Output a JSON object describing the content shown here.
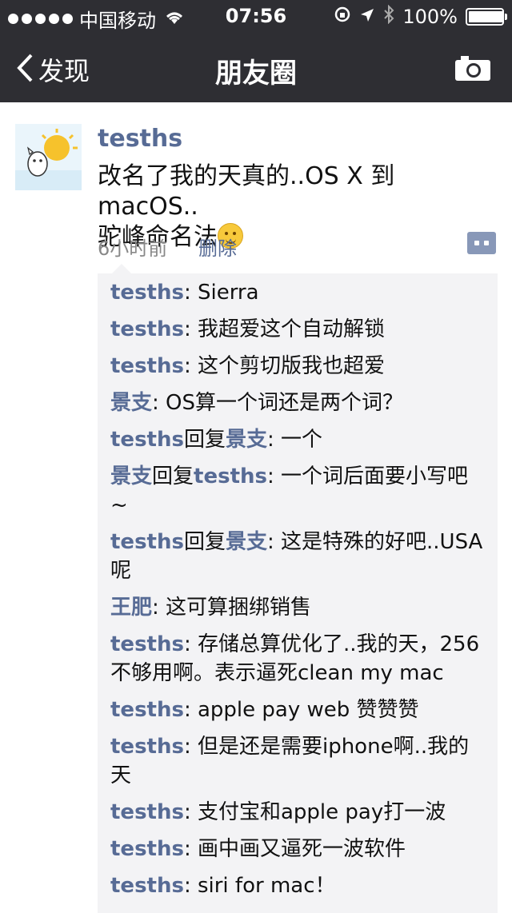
{
  "status_bar": {
    "carrier": "中国移动",
    "time": "07:56",
    "battery": "100%",
    "battery_fill": 1.0
  },
  "nav": {
    "back_label": "发现",
    "title": "朋友圈"
  },
  "post": {
    "username": "tesths",
    "text_line1": "改名了我的天真的..OS X 到 macOS..",
    "text_line2": "驼峰命名法",
    "time": "6小时前",
    "delete_label": "删除"
  },
  "comments": [
    {
      "from": "tesths",
      "to": "",
      "text": ": Sierra"
    },
    {
      "from": "tesths",
      "to": "",
      "text": ": 我超爱这个自动解锁"
    },
    {
      "from": "tesths",
      "to": "",
      "text": ": 这个剪切版我也超爱"
    },
    {
      "from": "景支",
      "to": "",
      "text": ": OS算一个词还是两个词？"
    },
    {
      "from": "tesths",
      "to": "景支",
      "text": ": 一个"
    },
    {
      "from": "景支",
      "to": "tesths",
      "text": ": 一个词后面要小写吧~"
    },
    {
      "from": "tesths",
      "to": "景支",
      "text": ": 这是特殊的好吧..USA呢"
    },
    {
      "from": "王肥",
      "to": "",
      "text": ": 这可算捆绑销售"
    },
    {
      "from": "tesths",
      "to": "",
      "text": ": 存储总算优化了..我的天，256不够用啊。表示逼死clean my mac"
    },
    {
      "from": "tesths",
      "to": "",
      "text": ": apple pay web 赞赞赞"
    },
    {
      "from": "tesths",
      "to": "",
      "text": ": 但是还是需要iphone啊..我的天"
    },
    {
      "from": "tesths",
      "to": "",
      "text": ": 支付宝和apple pay打一波"
    },
    {
      "from": "tesths",
      "to": "",
      "text": ": 画中画又逼死一波软件"
    },
    {
      "from": "tesths",
      "to": "",
      "text": ": siri for mac！"
    }
  ],
  "reply_word": "回复",
  "colors": {
    "header_bg": "#2e2e33",
    "link": "#576b95",
    "comment_bg": "#f3f3f5"
  }
}
